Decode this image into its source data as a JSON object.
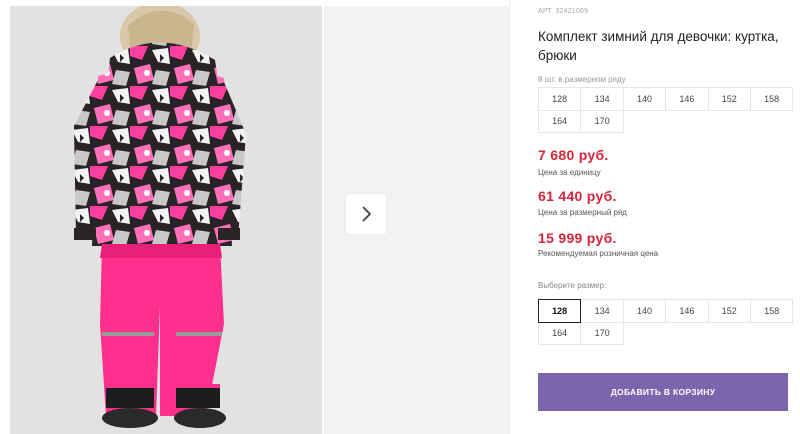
{
  "gallery": {
    "next_icon": "chevron-right-icon",
    "photo_alt": "product-photo"
  },
  "product": {
    "sku": "АРТ. 32421069",
    "title": "Комплект зимний для девочки: куртка, брюки",
    "pack_label": "8 шт. в размерном ряду",
    "pack_sizes": [
      "128",
      "134",
      "140",
      "146",
      "152",
      "158",
      "164",
      "170"
    ],
    "price_unit": "7 680 руб.",
    "price_unit_note": "Цена за единицу",
    "price_pack": "61 440 руб.",
    "price_pack_note": "Цена за размерный ряд",
    "price_retail": "15 999 руб.",
    "price_retail_note": "Рекомендуемая розничная цена",
    "select_label": "Выберите размер:",
    "select_sizes": [
      "128",
      "134",
      "140",
      "146",
      "152",
      "158",
      "164",
      "170"
    ],
    "selected_size": "128",
    "cart_button": "ДОБАВИТЬ В КОРЗИНУ"
  },
  "colors": {
    "price": "#d6243a",
    "button": "#7b66ad",
    "jacket_pink": "#ff3fa0",
    "pants_pink": "#ff2f8e"
  }
}
